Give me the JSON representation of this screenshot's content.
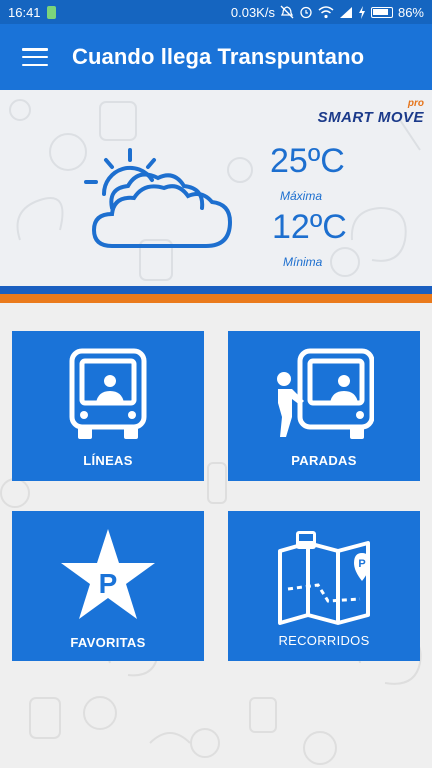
{
  "status_bar": {
    "time": "16:41",
    "network_speed": "0.03K/s",
    "battery": "86%"
  },
  "app_bar": {
    "title": "Cuando llega Transpuntano"
  },
  "brand": {
    "name": "SMART MOVE",
    "suffix": "pro"
  },
  "weather": {
    "icon": "partly-cloudy-icon",
    "max_temp": "25ºC",
    "max_label": "Máxima",
    "min_temp": "12ºC",
    "min_label": "Mínima"
  },
  "menu": {
    "lineas": "LÍNEAS",
    "paradas": "PARADAS",
    "favoritas": "FAVORITAS",
    "recorridos": "RECORRIDOS"
  },
  "colors": {
    "primary": "#1a73d8",
    "status_bar": "#1565c0",
    "stripe_blue": "#1a5fc0",
    "stripe_orange": "#ea7a1c"
  }
}
